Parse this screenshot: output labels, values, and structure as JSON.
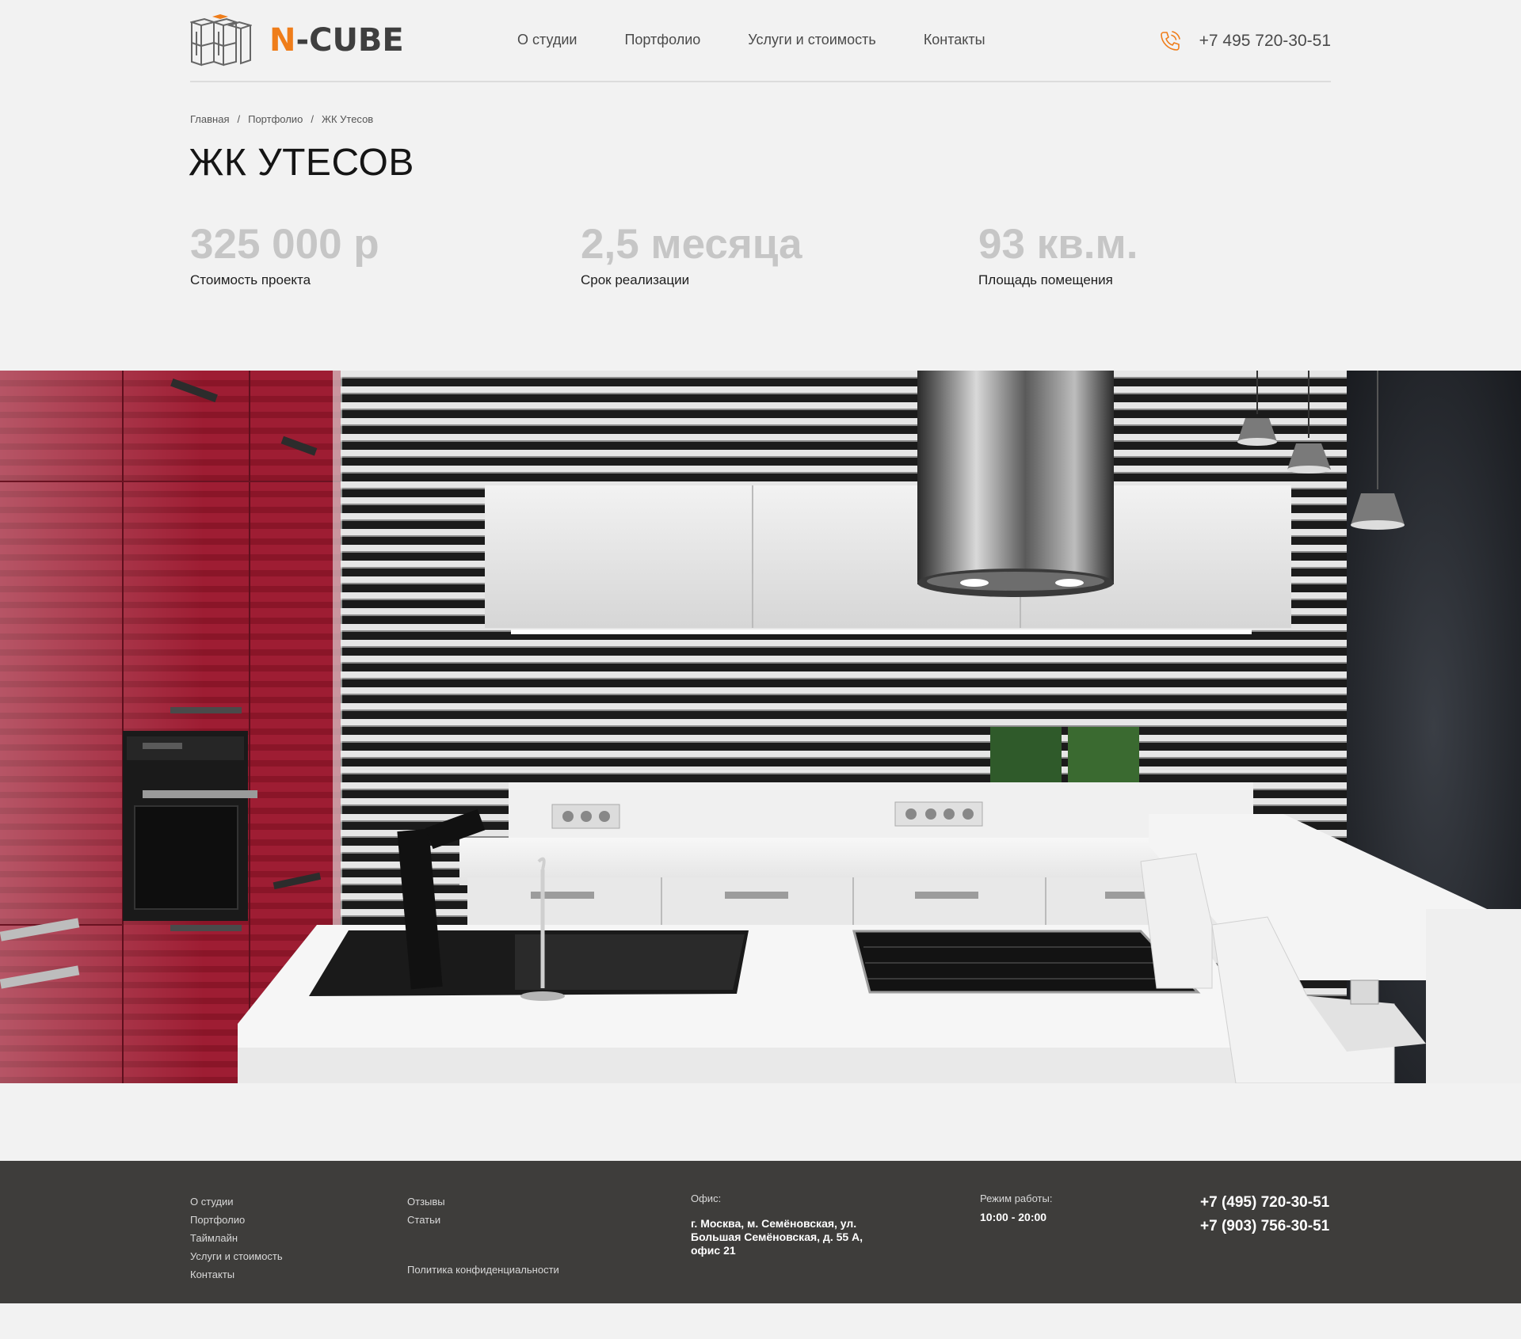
{
  "header": {
    "logo": {
      "prefix": "N",
      "suffix": "-CUBE"
    },
    "nav": [
      {
        "label": "О студии"
      },
      {
        "label": "Портфолио"
      },
      {
        "label": "Услуги и стоимость"
      },
      {
        "label": "Контакты"
      }
    ],
    "phone": "+7 495 720-30-51"
  },
  "breadcrumb": {
    "items": [
      "Главная",
      "Портфолио",
      "ЖК Утесов"
    ],
    "separator": "/"
  },
  "page": {
    "title": "ЖК УТЕСОВ"
  },
  "stats": [
    {
      "value": "325 000 р",
      "label": "Стоимость проекта"
    },
    {
      "value": "2,5 месяца",
      "label": "Срок реализации"
    },
    {
      "value": "93 кв.м.",
      "label": "Площадь помещения"
    }
  ],
  "hero": {
    "icon": "kitchen-photo"
  },
  "footer": {
    "col1": [
      "О студии",
      "Портфолио",
      "Таймлайн",
      "Услуги и стоимость",
      "Контакты"
    ],
    "col2": [
      "Отзывы",
      "Статьи"
    ],
    "privacy": "Политика конфиденциальности",
    "office_label": "Офис:",
    "office_address": "г. Москва, м. Семёновская, ул. Большая Семёновская, д. 55 А, офис 21",
    "hours_label": "Режим работы:",
    "hours_value": "10:00 - 20:00",
    "phones": [
      "+7 (495) 720-30-51",
      "+7 (903) 756-30-51"
    ]
  },
  "colors": {
    "accent": "#ef7d1a",
    "background": "#f2f2f2",
    "footer": "#3e3d3b",
    "stat_value": "#c6c6c6"
  }
}
